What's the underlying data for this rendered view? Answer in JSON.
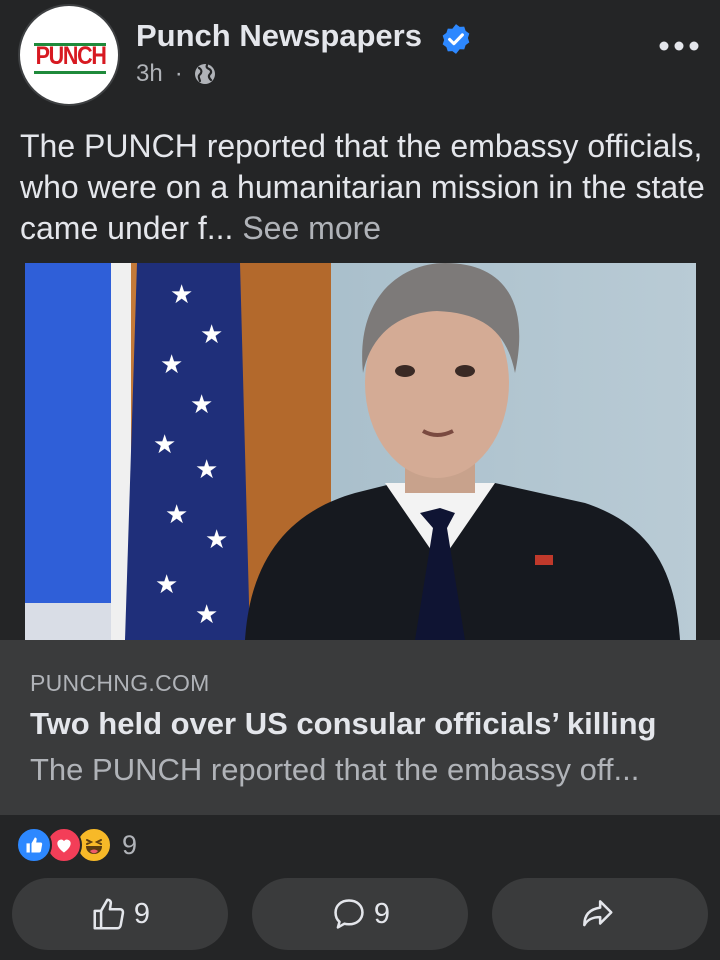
{
  "post": {
    "page_name": "Punch Newspapers",
    "avatar_text": "PUNCH",
    "time": "3h",
    "separator": "·",
    "audience_icon": "globe-icon",
    "verified_icon": "verified-badge-icon",
    "more_icon": "more-options-icon",
    "text": "The PUNCH reported that the embassy officials, who were on a humanitarian mission in the state came under f...",
    "see_more": "See more"
  },
  "link": {
    "domain": "PUNCHNG.COM",
    "title": "Two held over US consular officials’ killing",
    "description": "The PUNCH reported that the embassy off..."
  },
  "reactions": {
    "icons": [
      "like-reaction-icon",
      "love-reaction-icon",
      "haha-reaction-icon"
    ],
    "count": "9"
  },
  "actions": {
    "like_count": "9",
    "comment_count": "9"
  },
  "colors": {
    "background": "#242526",
    "card": "#3a3b3c",
    "accent": "#2d88ff"
  }
}
